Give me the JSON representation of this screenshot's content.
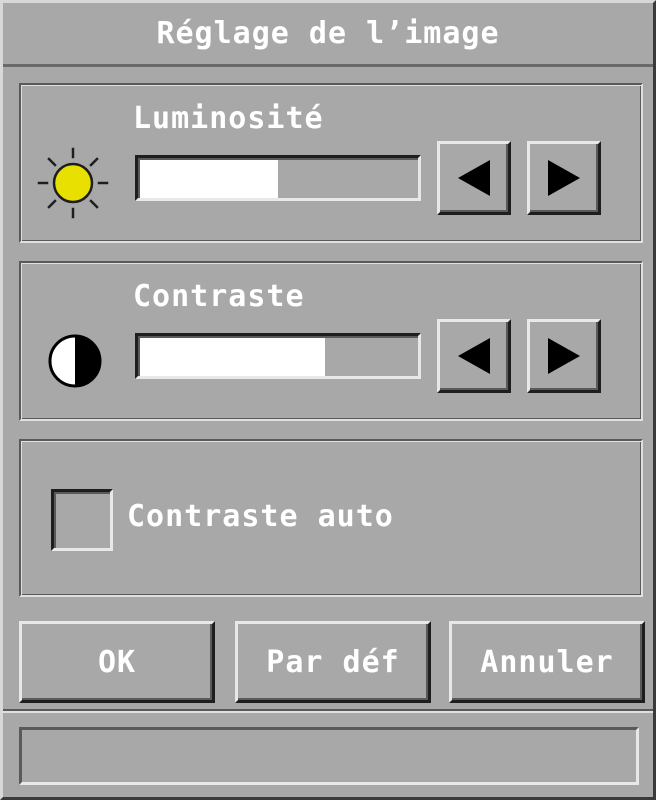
{
  "dialog": {
    "title": "Réglage de l’image"
  },
  "brightness": {
    "label": "Luminosité",
    "icon": "sun-icon",
    "level": 0.5,
    "decrease_icon": "arrow-left-icon",
    "increase_icon": "arrow-right-icon"
  },
  "contrast": {
    "label": "Contraste",
    "icon": "half-circle-contrast-icon",
    "level": 0.67,
    "decrease_icon": "arrow-left-icon",
    "increase_icon": "arrow-right-icon"
  },
  "auto_contrast": {
    "label": "Contraste auto",
    "checked": false
  },
  "buttons": {
    "ok": "OK",
    "default": "Par déf",
    "cancel": "Annuler"
  },
  "status": {
    "text": ""
  },
  "colors": {
    "dialog_bg": "#a8a8a8",
    "text": "#ffffff",
    "sun": "#e8e000",
    "slider_fill": "#ffffff"
  }
}
